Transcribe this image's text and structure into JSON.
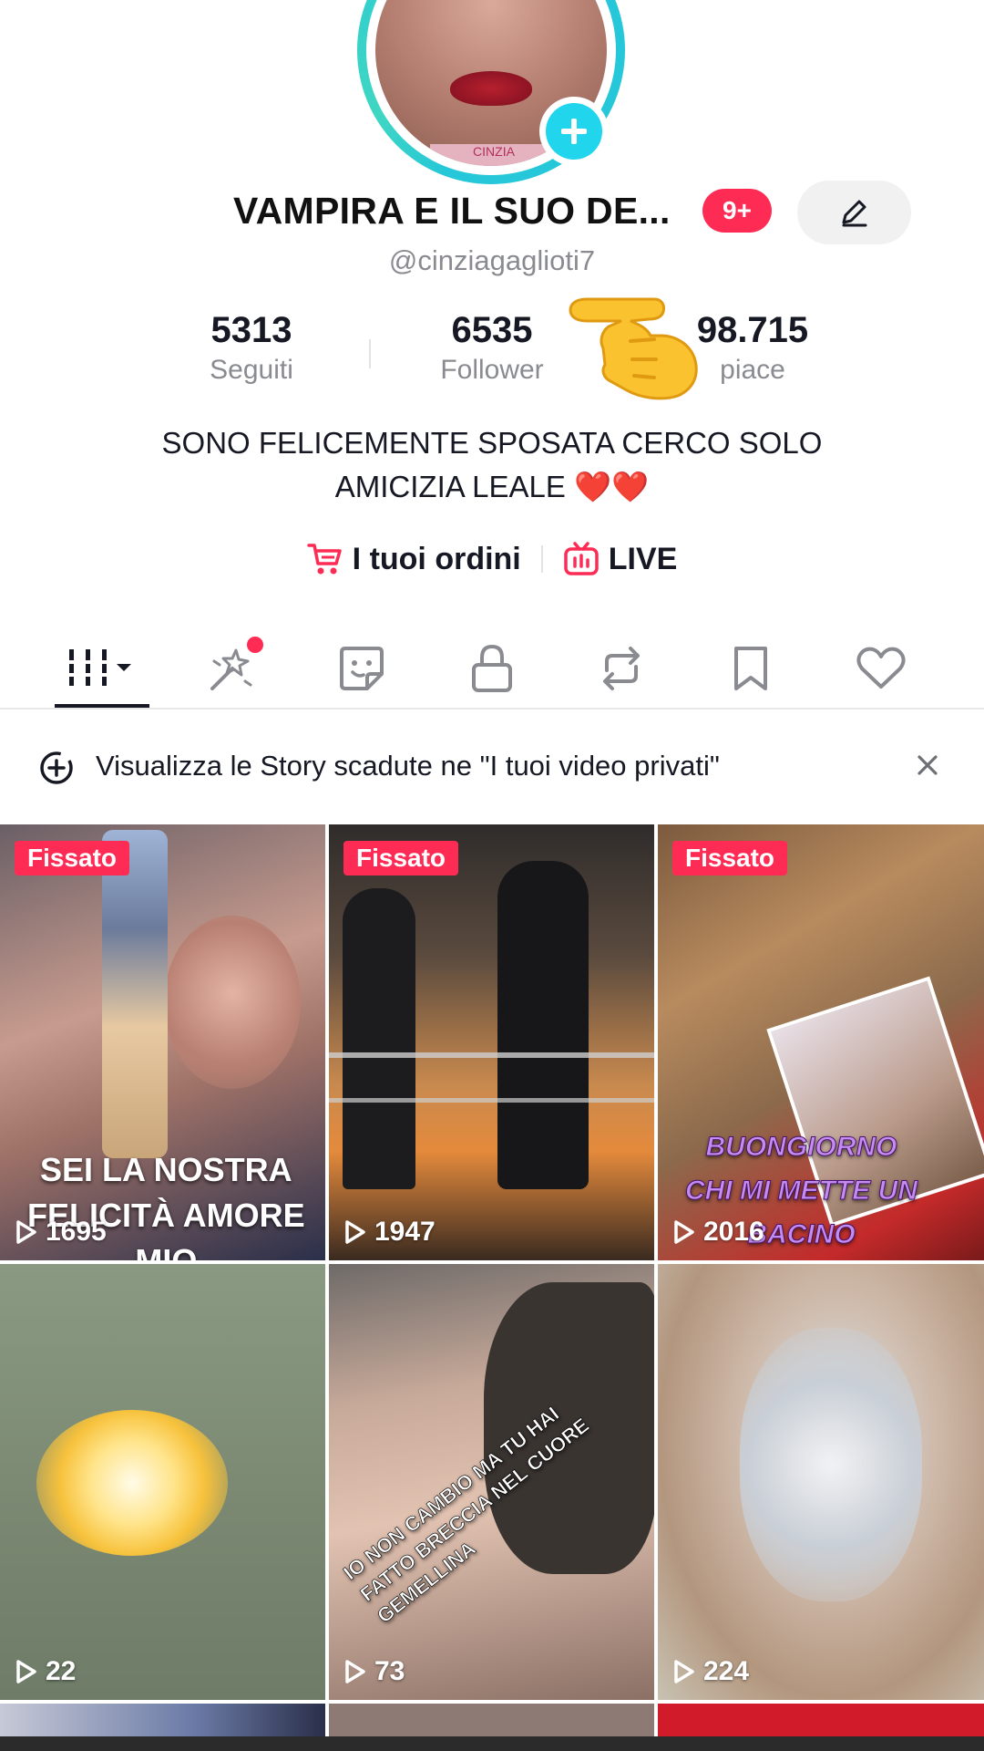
{
  "profile": {
    "display_name": "VAMPIRA E IL SUO DE...",
    "notification_badge": "9+",
    "username": "@cinziagaglioti7",
    "avatar_caption": "CINZIA"
  },
  "stats": {
    "following": {
      "value": "5313",
      "label": "Seguiti"
    },
    "followers": {
      "value": "6535",
      "label": "Follower"
    },
    "likes": {
      "value": "98.715",
      "label": "piace"
    }
  },
  "bio": {
    "line1": "SONO FELICEMENTE SPOSATA CERCO SOLO",
    "line2": "AMICIZIA  LEALE",
    "hearts": "❤️❤️"
  },
  "links": {
    "orders_label": "I tuoi ordini",
    "live_label": "LIVE"
  },
  "tabs": [
    "videos",
    "favorites-effects",
    "stickers",
    "private",
    "reposts",
    "saved",
    "liked"
  ],
  "banner": {
    "text": "Visualizza le Story scadute ne \"I tuoi video privati\""
  },
  "grid": {
    "pinned_label": "Fissato",
    "items": [
      {
        "views": "1695",
        "pinned": true,
        "overlay": "SEI LA NOSTRA\nFELICITÀ AMORE\nMIO"
      },
      {
        "views": "1947",
        "pinned": true,
        "overlay": ""
      },
      {
        "views": "2016",
        "pinned": true,
        "overlay": "BUONGIORNO\nCHI MI METTE UN\nBACINO"
      },
      {
        "views": "22",
        "pinned": false,
        "overlay": ""
      },
      {
        "views": "73",
        "pinned": false,
        "overlay": "IO NON CAMBIO MA TU HAI FATTO BRECCIA NEL CUORE GEMELLINA"
      },
      {
        "views": "224",
        "pinned": false,
        "overlay": ""
      }
    ]
  },
  "colors": {
    "accent": "#fe2c55",
    "avatar_ring": "#25c7d9",
    "add_button": "#20d5ec",
    "text_primary": "#161823",
    "text_secondary": "#8a8b91"
  }
}
